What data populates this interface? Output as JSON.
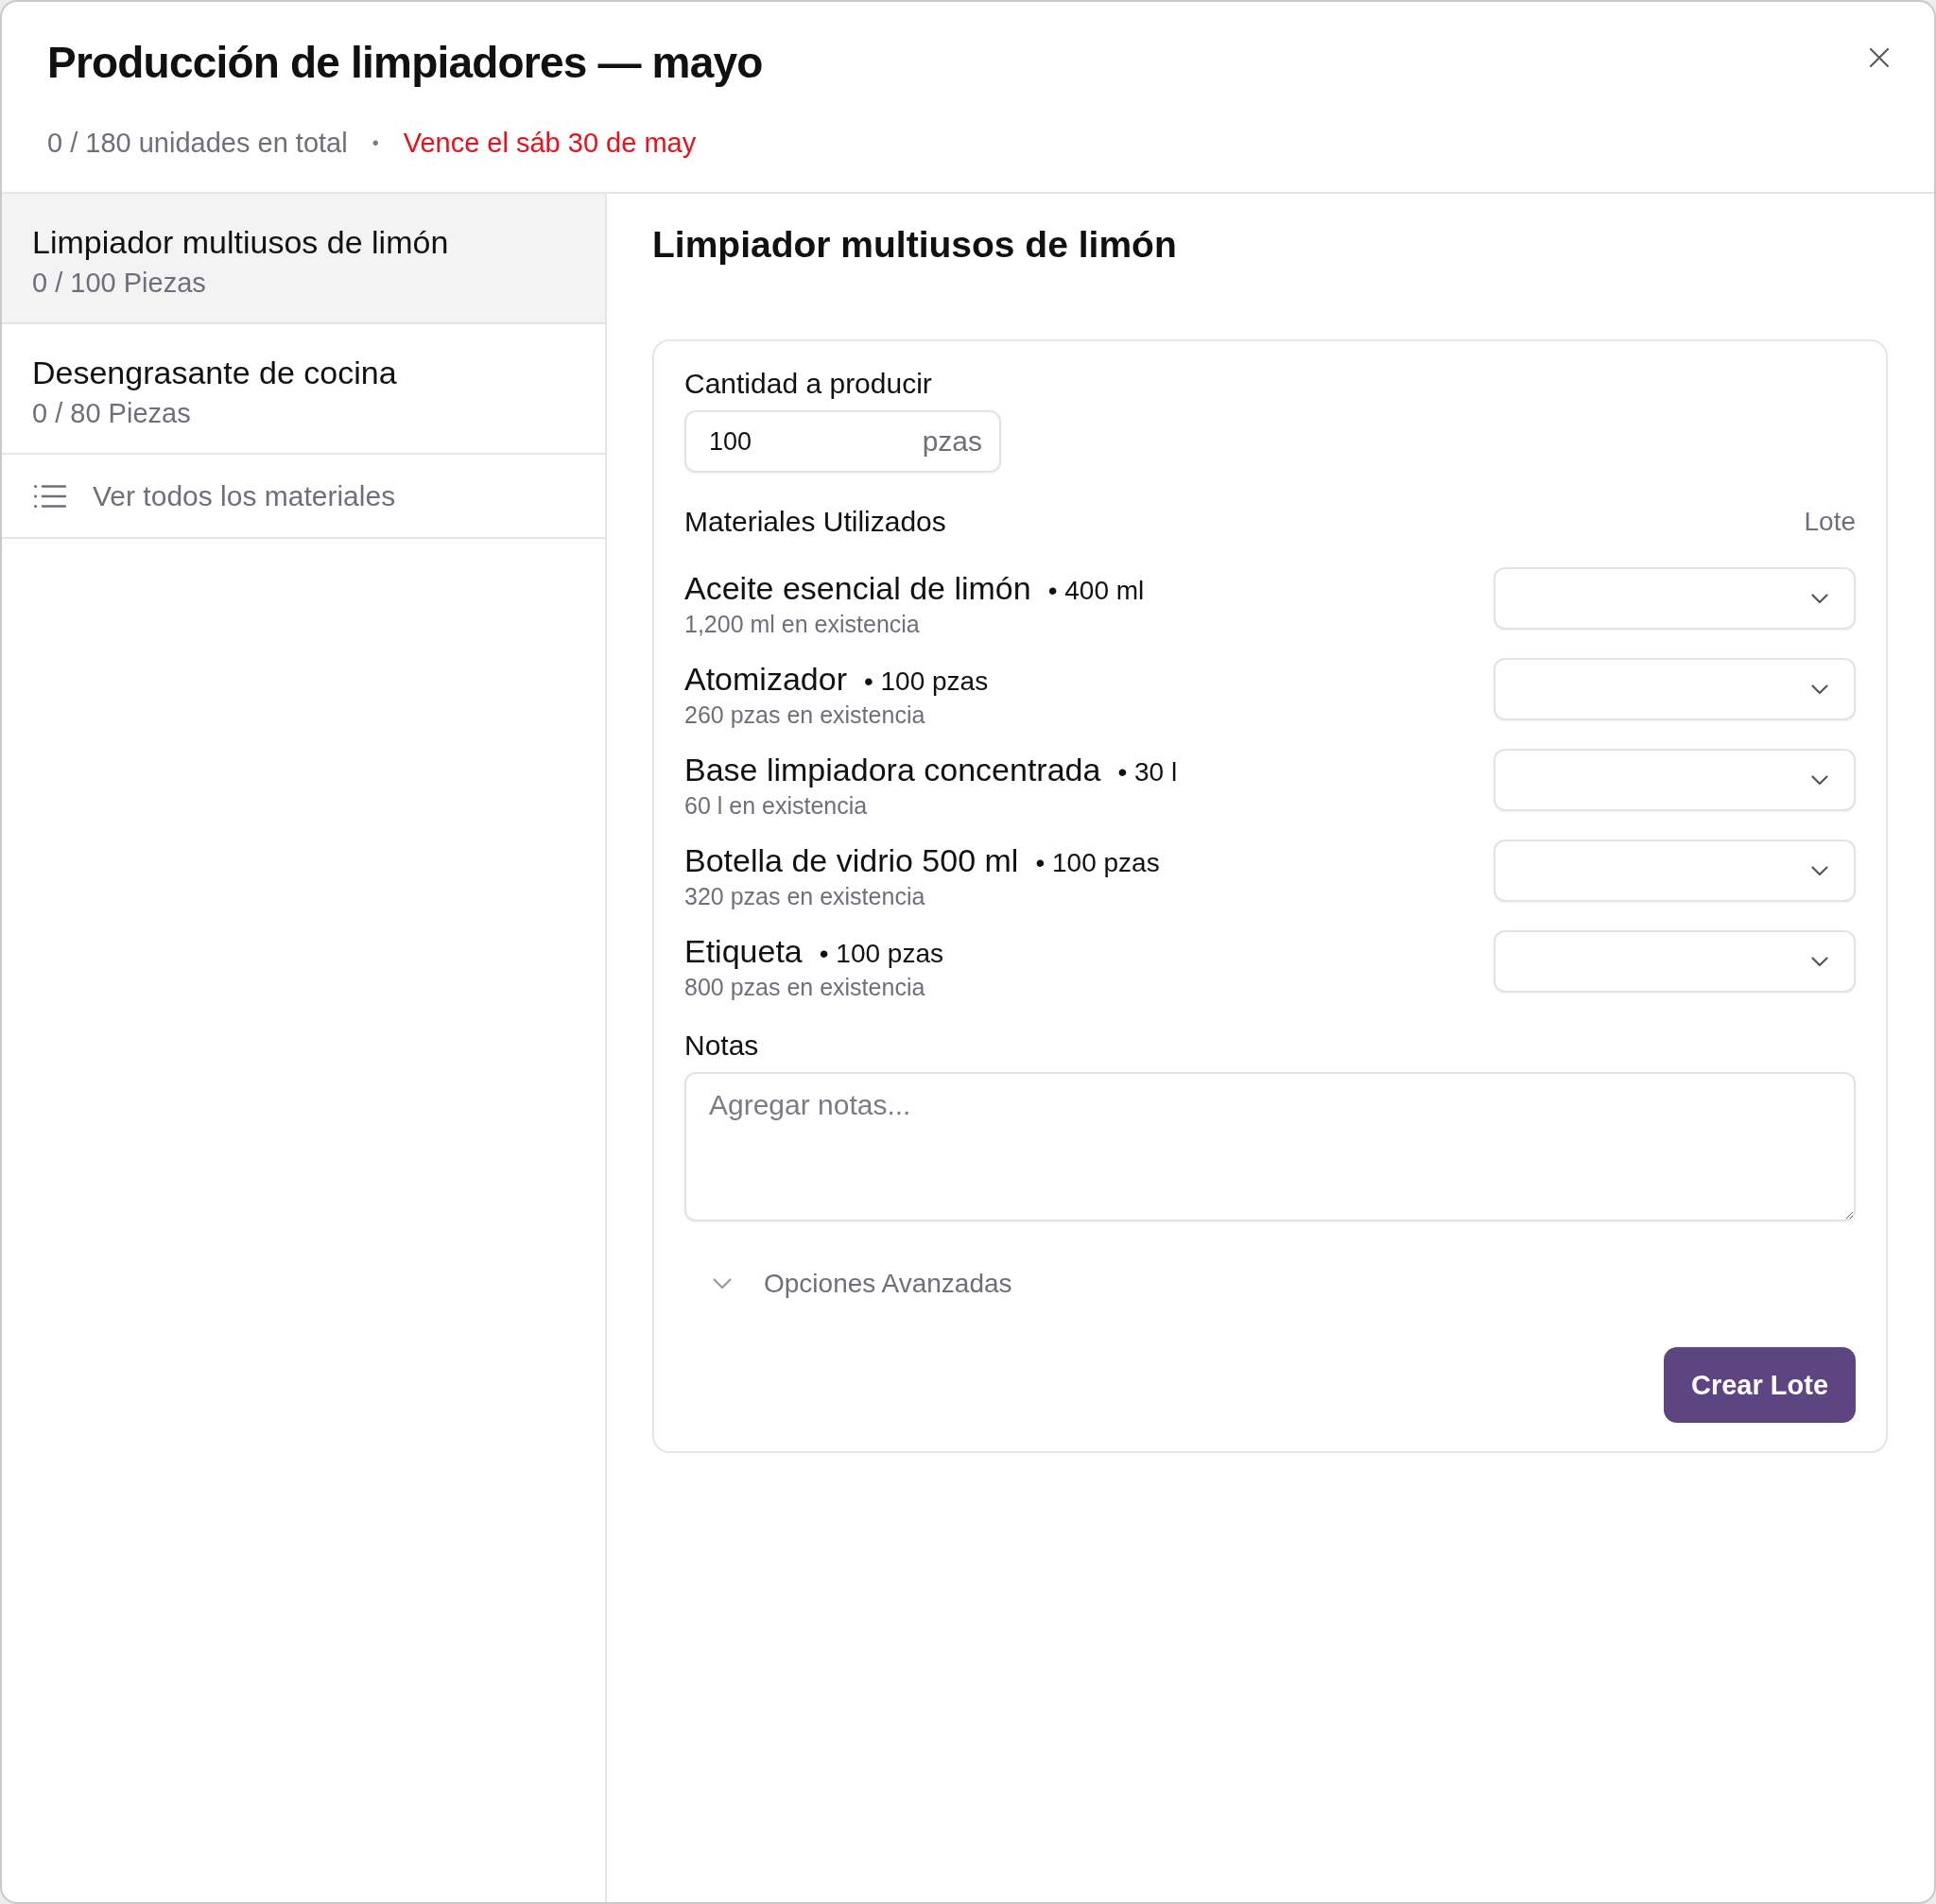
{
  "window": {
    "title": "Producción de limpiadores — mayo",
    "total": "0 / 180 unidades en total",
    "separator": "•",
    "due": "Vence el sáb 30 de may"
  },
  "sidebar": {
    "items": [
      {
        "name": "Limpiador multiusos de limón",
        "progress": "0 / 100 Piezas",
        "selected": true
      },
      {
        "name": "Desengrasante de cocina",
        "progress": "0 / 80 Piezas",
        "selected": false
      }
    ],
    "link": "Ver todos los materiales"
  },
  "detail": {
    "title": "Limpiador multiusos de limón",
    "quantity": {
      "label": "Cantidad a producir",
      "value": "100",
      "unit": "pzas"
    },
    "materials": {
      "label": "Materiales Utilizados",
      "column": "Lote",
      "rows": [
        {
          "name": "Aceite esencial de limón",
          "amount": "• 400 ml",
          "stock": "1,200 ml en existencia"
        },
        {
          "name": "Atomizador",
          "amount": "• 100 pzas",
          "stock": "260 pzas en existencia"
        },
        {
          "name": "Base limpiadora concentrada",
          "amount": "• 30 l",
          "stock": "60 l en existencia"
        },
        {
          "name": "Botella de vidrio 500 ml",
          "amount": "• 100 pzas",
          "stock": "320 pzas en existencia"
        },
        {
          "name": "Etiqueta",
          "amount": "• 100 pzas",
          "stock": "800 pzas en existencia"
        }
      ]
    },
    "notes": {
      "label": "Notas",
      "placeholder": "Agregar notas..."
    },
    "advanced": {
      "label": "Opciones Avanzadas",
      "expanded": false
    },
    "submit": "Crear Lote"
  }
}
